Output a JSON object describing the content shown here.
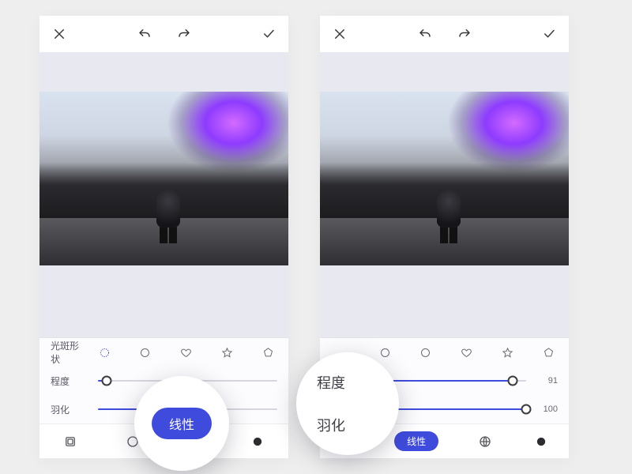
{
  "left": {
    "shape_label": "光斑形状",
    "amount_label": "程度",
    "feather_label": "羽化",
    "amount_value": 5,
    "feather_value": 40,
    "pill": "线性"
  },
  "right": {
    "shape_label": "",
    "amount_label": "程度",
    "feather_label": "羽化",
    "amount_value": 91,
    "feather_value": 100,
    "pill": "线性"
  },
  "bubble1_pill": "线性",
  "bubble2_labels": {
    "a": "程度",
    "b": "羽化"
  }
}
